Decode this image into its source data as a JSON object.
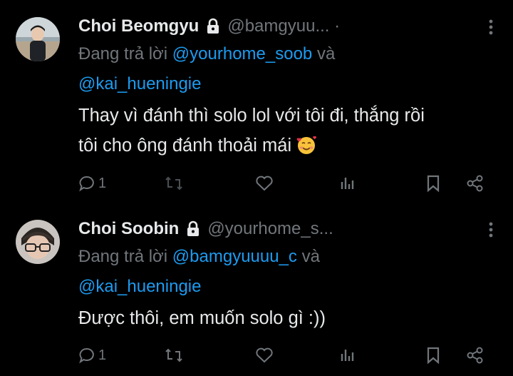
{
  "tweets": [
    {
      "name": "Choi Beomgyu",
      "handle": "@bamgyuu... ·",
      "reply_prefix": "Đang trả lời",
      "reply_to_1": "@yourhome_soob",
      "reply_and": "và",
      "reply_to_2": "@kai_hueningie",
      "text_line_1": "Thay vì đánh thì solo lol với tôi đi, thắng rồi",
      "text_line_2": "tôi cho ông đánh thoải mái",
      "emoji": "smiling-face-with-hearts",
      "reply_count": "1",
      "verified_lock": "lock-icon"
    },
    {
      "name": "Choi Soobin",
      "handle": "@yourhome_s...",
      "reply_prefix": "Đang trả lời",
      "reply_to_1": "@bamgyuuuu_c",
      "reply_and": "và",
      "reply_to_2": "@kai_hueningie",
      "text_line_1": "Được thôi, em muốn solo gì :))",
      "reply_count": "1",
      "verified_lock": "lock-icon"
    }
  ],
  "colors": {
    "background": "#000000",
    "text": "#e7e9ea",
    "secondary": "#71767b",
    "link": "#1d9bf0"
  }
}
